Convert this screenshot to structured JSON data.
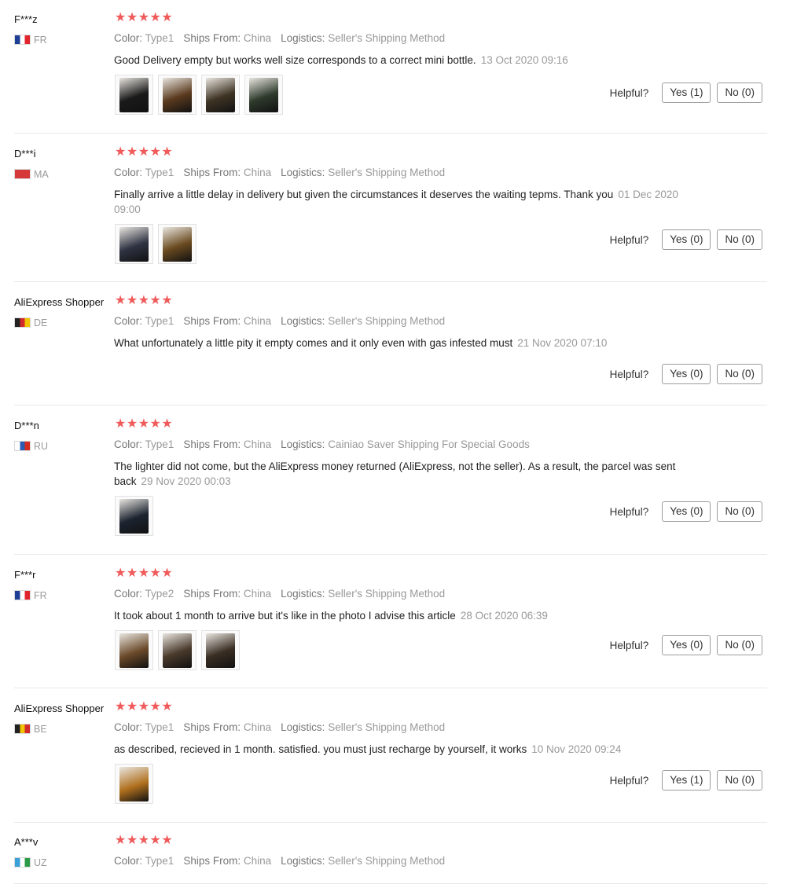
{
  "labels": {
    "color": "Color:",
    "ships_from": "Ships From:",
    "logistics": "Logistics:",
    "helpful": "Helpful?"
  },
  "reviews": [
    {
      "user": "F***z",
      "country": "FR",
      "flag": [
        "#1f3f95",
        "#ffffff",
        "#e0262d"
      ],
      "stars": "★★★★★",
      "color": "Type1",
      "ships_from": "China",
      "logistics": "Seller's Shipping Method",
      "text": "Good Delivery empty but works well size corresponds to a correct mini bottle.",
      "date": "13 Oct 2020 09:16",
      "yes": "Yes (1)",
      "no": "No (0)",
      "thumbs": [
        {
          "name": "review-photo",
          "tone": "#1a1a1a"
        },
        {
          "name": "review-photo",
          "tone": "#5a3a1e"
        },
        {
          "name": "review-photo",
          "tone": "#3f3424"
        },
        {
          "name": "review-photo",
          "tone": "#2e3a2c"
        }
      ]
    },
    {
      "user": "D***i",
      "country": "MA",
      "flag": [
        "#d6393a",
        "#d6393a",
        "#d6393a"
      ],
      "stars": "★★★★★",
      "color": "Type1",
      "ships_from": "China",
      "logistics": "Seller's Shipping Method",
      "text": "Finally arrive a little delay in delivery but given the circumstances it deserves the waiting tepms. Thank you",
      "date": "01 Dec 2020 09:00",
      "yes": "Yes (0)",
      "no": "No (0)",
      "thumbs": [
        {
          "name": "review-photo",
          "tone": "#2f3342"
        },
        {
          "name": "review-photo",
          "tone": "#6a4a20"
        }
      ]
    },
    {
      "user": "AliExpress Shopper",
      "country": "DE",
      "flag": [
        "#222222",
        "#d22b2b",
        "#f2c300"
      ],
      "stars": "★★★★★",
      "color": "Type1",
      "ships_from": "China",
      "logistics": "Seller's Shipping Method",
      "text": "What unfortunately a little pity it empty comes and it only even with gas infested must",
      "date": "21 Nov 2020 07:10",
      "yes": "Yes (0)",
      "no": "No (0)",
      "thumbs": []
    },
    {
      "user": "D***n",
      "country": "RU",
      "flag": [
        "#ffffff",
        "#2c5bb4",
        "#d52b1e"
      ],
      "stars": "★★★★★",
      "color": "Type1",
      "ships_from": "China",
      "logistics": "Cainiao Saver Shipping For Special Goods",
      "text": "The lighter did not come, but the AliExpress money returned (AliExpress, not the seller). As a result, the parcel was sent back",
      "date": "29 Nov 2020 00:03",
      "yes": "Yes (0)",
      "no": "No (0)",
      "thumbs": [
        {
          "name": "review-photo",
          "tone": "#1c2430"
        }
      ]
    },
    {
      "user": "F***r",
      "country": "FR",
      "flag": [
        "#1f3f95",
        "#ffffff",
        "#e0262d"
      ],
      "stars": "★★★★★",
      "color": "Type2",
      "ships_from": "China",
      "logistics": "Seller's Shipping Method",
      "text": "It took about 1 month to arrive but it's like in the photo I advise this article",
      "date": "28 Oct 2020 06:39",
      "yes": "Yes (0)",
      "no": "No (0)",
      "thumbs": [
        {
          "name": "review-photo",
          "tone": "#6b4a2a"
        },
        {
          "name": "review-photo",
          "tone": "#4a3a2c"
        },
        {
          "name": "review-photo",
          "tone": "#3a2e24"
        }
      ]
    },
    {
      "user": "AliExpress Shopper",
      "country": "BE",
      "flag": [
        "#222222",
        "#f2c300",
        "#d22b2b"
      ],
      "stars": "★★★★★",
      "color": "Type1",
      "ships_from": "China",
      "logistics": "Seller's Shipping Method",
      "text": "as described, recieved in 1 month. satisfied. you must just recharge by yourself, it works",
      "date": "10 Nov 2020 09:24",
      "yes": "Yes (1)",
      "no": "No (0)",
      "thumbs": [
        {
          "name": "review-photo",
          "tone": "#b0701e"
        }
      ]
    },
    {
      "user": "A***v",
      "country": "UZ",
      "flag": [
        "#3aa0d8",
        "#ffffff",
        "#2c9b48"
      ],
      "stars": "★★★★★",
      "color": "Type1",
      "ships_from": "China",
      "logistics": "Seller's Shipping Method",
      "text": "",
      "date": "",
      "yes": "",
      "no": "",
      "thumbs": []
    }
  ]
}
